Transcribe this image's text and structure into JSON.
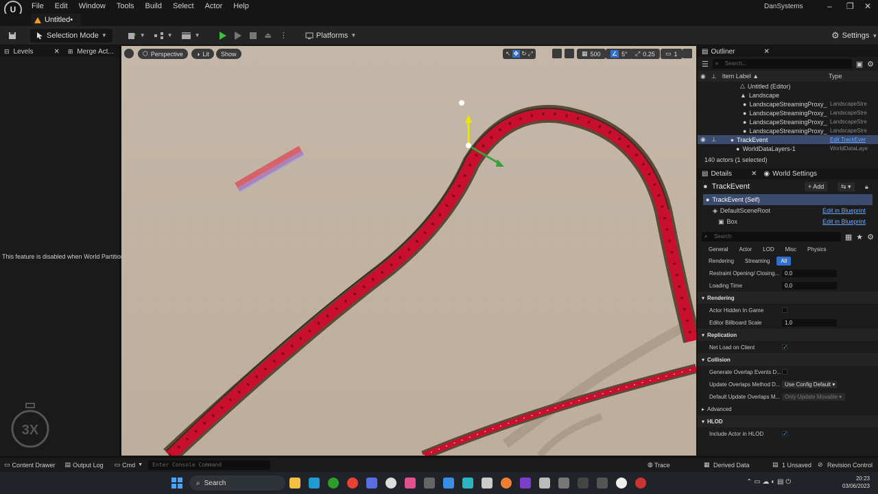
{
  "menu": {
    "items": [
      "File",
      "Edit",
      "Window",
      "Tools",
      "Build",
      "Select",
      "Actor",
      "Help"
    ],
    "account": "DanSystems"
  },
  "document_tab": {
    "label": "Untitled•"
  },
  "toolbar": {
    "selection_mode": "Selection Mode",
    "platforms": "Platforms",
    "settings": "Settings"
  },
  "left_panel": {
    "tab_levels": "Levels",
    "tab_merge": "Merge Act...",
    "disabled_message": "This feature is disabled when World Partition",
    "speed_badge": "3X"
  },
  "viewport": {
    "perspective": "Perspective",
    "lit": "Lit",
    "show": "Show",
    "grid_size": "500",
    "rotation_snap": "5°",
    "scale_snap": "0.25",
    "camera_speed": "1"
  },
  "outliner": {
    "title": "Outliner",
    "search_placeholder": "Search...",
    "col_label": "Item Label ▲",
    "col_type": "Type",
    "rows": [
      {
        "label": "Untitled (Editor)",
        "type": "",
        "indent": 1
      },
      {
        "label": "Landscape",
        "type": "",
        "indent": 2
      },
      {
        "label": "LandscapeStreamingProxy_",
        "type": "LandscapeStre",
        "indent": 3
      },
      {
        "label": "LandscapeStreamingProxy_",
        "type": "LandscapeStre",
        "indent": 3
      },
      {
        "label": "LandscapeStreamingProxy_",
        "type": "LandscapeStre",
        "indent": 3
      },
      {
        "label": "LandscapeStreamingProxy_",
        "type": "LandscapeStre",
        "indent": 3
      },
      {
        "label": "TrackEvent",
        "type": "Edit TrackEver",
        "indent": 2,
        "selected": true
      },
      {
        "label": "WorldDataLayers-1",
        "type": "WorldDataLaye",
        "indent": 2
      }
    ],
    "actor_count": "140 actors (1 selected)"
  },
  "details": {
    "tab_details": "Details",
    "tab_world_settings": "World Settings",
    "actor_name": "TrackEvent",
    "add_button": "+ Add",
    "components": [
      {
        "label": "TrackEvent (Self)",
        "link": ""
      },
      {
        "label": "DefaultSceneRoot",
        "link": "Edit in Blueprint"
      },
      {
        "label": "Box",
        "link": "Edit in Blueprint"
      }
    ],
    "search_placeholder": "Search",
    "categories": [
      "General",
      "Actor",
      "LOD",
      "Misc",
      "Physics",
      "Rendering",
      "Streaming",
      "All"
    ],
    "props_top": [
      {
        "label": "Restraint Opening/ Closing...",
        "value": "0.0"
      },
      {
        "label": "Loading Time",
        "value": "0.0"
      }
    ],
    "section_rendering": "Rendering",
    "prop_hidden": "Actor Hidden In Game",
    "prop_billboard": {
      "label": "Editor Billboard Scale",
      "value": "1.0"
    },
    "section_replication": "Replication",
    "prop_netload": "Net Load on Client",
    "section_collision": "Collision",
    "prop_overlap": "Generate Overlap Events D...",
    "prop_update_overlap": {
      "label": "Update Overlaps Method D...",
      "value": "Use Config Default"
    },
    "prop_default_update": {
      "label": "Default Update Overlaps M...",
      "value": "Only Update Movable"
    },
    "section_advanced": "Advanced",
    "section_hlod": "HLOD",
    "prop_hlod": "Include Actor in HLOD"
  },
  "statusbar": {
    "content_drawer": "Content Drawer",
    "output_log": "Output Log",
    "cmd": "Cmd",
    "console_placeholder": "Enter Console Command",
    "trace": "Trace",
    "derived_data": "Derived Data",
    "unsaved": "1 Unsaved",
    "revision": "Revision Control"
  },
  "taskbar": {
    "search": "Search",
    "time": "20:23",
    "date": "03/06/2023"
  }
}
